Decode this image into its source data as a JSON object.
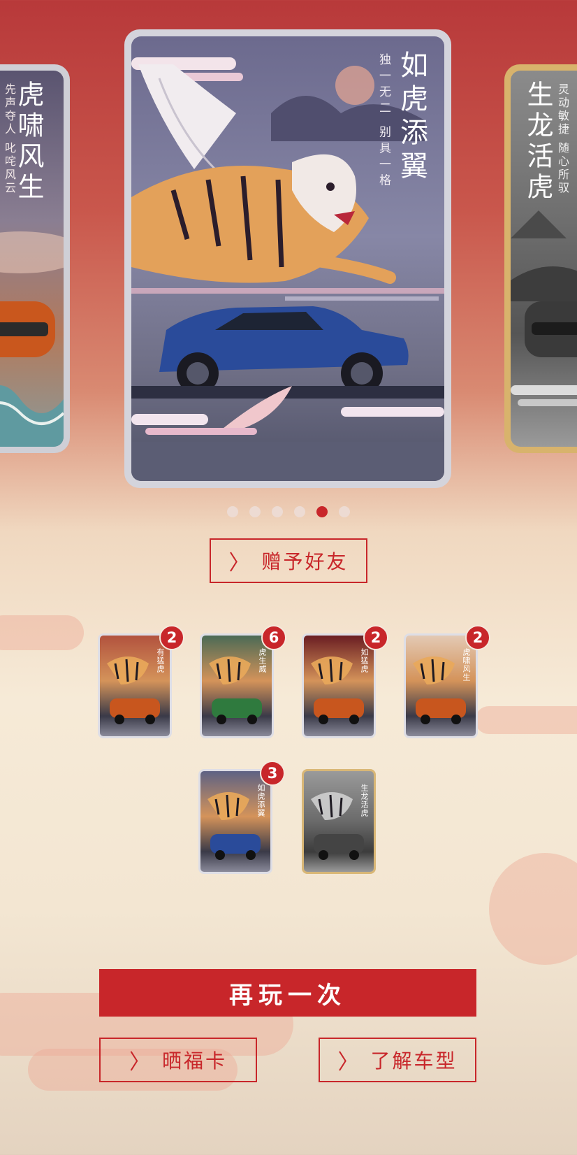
{
  "carousel": {
    "left_card": {
      "title": "虎啸风生",
      "subtitle": "先声夺人 叱咤风云"
    },
    "main_card": {
      "title": "如虎添翼",
      "subtitle": "独一无二 别具一格"
    },
    "right_card": {
      "title": "生龙活虎",
      "subtitle": "灵动敏捷 随心所驭"
    },
    "dots_count": 6,
    "active_dot_index": 4
  },
  "gift_button": {
    "label": "赠予好友"
  },
  "collection": [
    {
      "name": "有猛虎",
      "count": "2",
      "bg": "#b2523e"
    },
    {
      "name": "虎生威",
      "count": "6",
      "bg": "#4b6a55"
    },
    {
      "name": "如猛虎",
      "count": "2",
      "bg": "#6a1d22"
    },
    {
      "name": "虎啸风生",
      "count": "2",
      "bg": "#e3c9b4"
    },
    {
      "name": "如虎添翼",
      "count": "3",
      "bg": "#5e6284"
    },
    {
      "name": "生龙活虎",
      "count": "",
      "bg": "#6b6b6b"
    }
  ],
  "play_again_button": {
    "label": "再玩一次"
  },
  "share_button": {
    "label": "晒福卡"
  },
  "learn_button": {
    "label": "了解车型"
  },
  "colors": {
    "accent": "#c8262a",
    "card_frame_silver": "#d4d4dc",
    "card_frame_gold": "#d9b776"
  }
}
